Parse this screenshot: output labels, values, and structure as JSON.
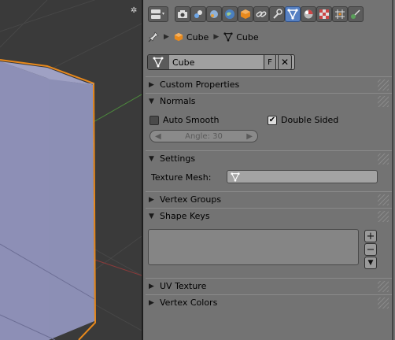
{
  "header": {
    "tabs": [
      {
        "name": "render-tab",
        "icon": "camera-icon"
      },
      {
        "name": "render-layers-tab",
        "icon": "render-layers-icon"
      },
      {
        "name": "scene-tab",
        "icon": "scene-icon"
      },
      {
        "name": "world-tab",
        "icon": "world-icon"
      },
      {
        "name": "object-tab",
        "icon": "object-cube-icon"
      },
      {
        "name": "constraints-tab",
        "icon": "chain-link-icon"
      },
      {
        "name": "modifiers-tab",
        "icon": "wrench-icon"
      },
      {
        "name": "data-tab",
        "icon": "mesh-data-icon",
        "active": true
      },
      {
        "name": "material-tab",
        "icon": "material-sphere-icon"
      },
      {
        "name": "texture-tab",
        "icon": "checker-texture-icon"
      },
      {
        "name": "particles-tab",
        "icon": "particles-icon"
      },
      {
        "name": "physics-tab",
        "icon": "physics-icon"
      }
    ]
  },
  "breadcrumb": {
    "object_label": "Cube",
    "mesh_label": "Cube"
  },
  "datablock": {
    "name_value": "Cube",
    "fake_user_label": "F",
    "unlink_label": "✕"
  },
  "panels": {
    "custom_properties": "Custom Properties",
    "normals": "Normals",
    "settings": "Settings",
    "vertex_groups": "Vertex Groups",
    "shape_keys": "Shape Keys",
    "uv_texture": "UV Texture",
    "vertex_colors": "Vertex Colors"
  },
  "normals": {
    "auto_smooth_label": "Auto Smooth",
    "auto_smooth_checked": false,
    "double_sided_label": "Double Sided",
    "double_sided_checked": true,
    "angle_label": "Angle: 30"
  },
  "settings": {
    "texture_mesh_label": "Texture Mesh:"
  },
  "shape_keys": {
    "add_label": "+",
    "remove_label": "−",
    "menu_label": "▼"
  },
  "colors": {
    "active_tab": "#5680c2",
    "viewport_bg": "#3a3a3a",
    "cube_face": "#8d8fb6",
    "cube_outline": "#e8891c",
    "panel_bg": "#737373"
  }
}
